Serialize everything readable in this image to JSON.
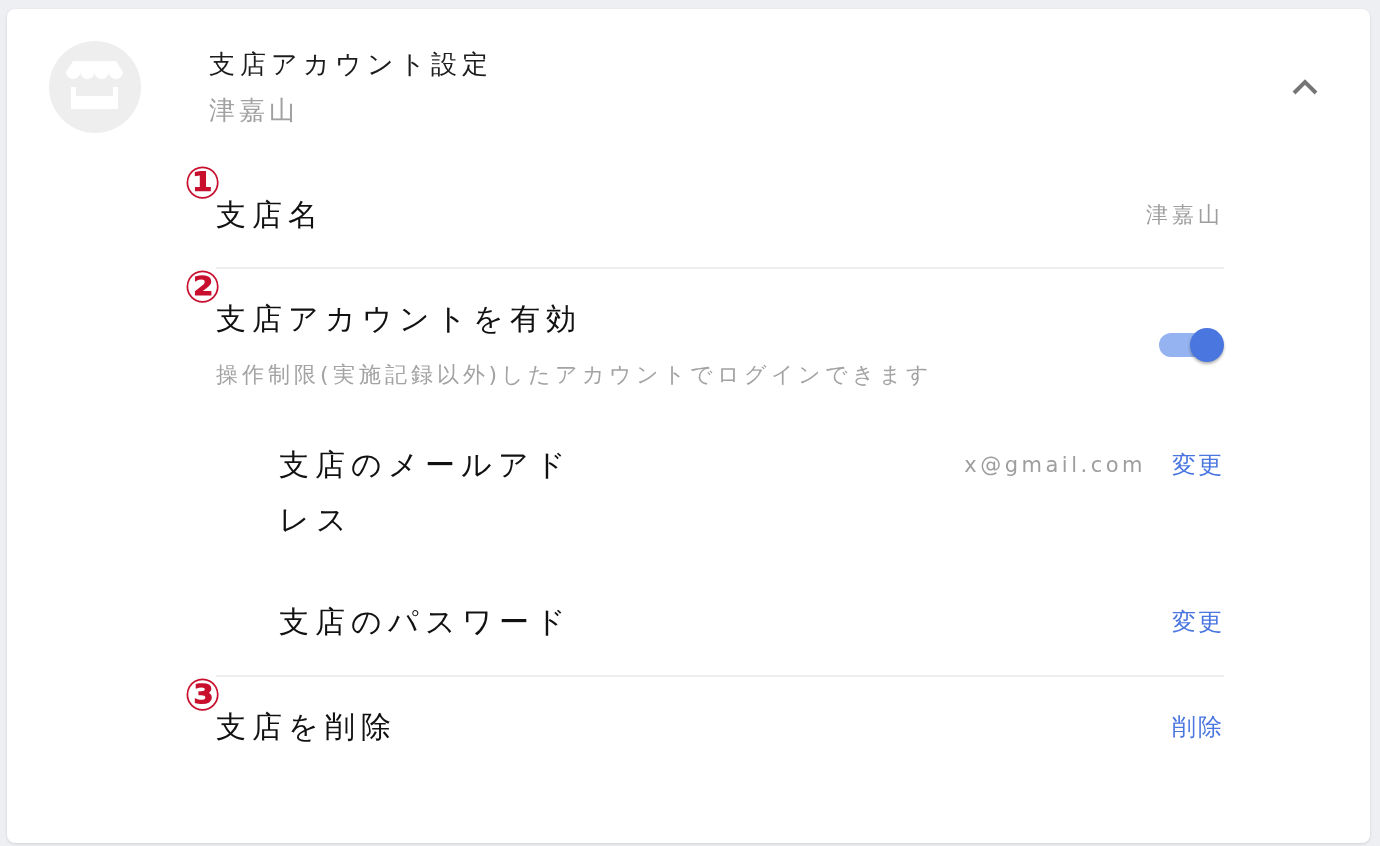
{
  "panel": {
    "title": "支店アカウント設定",
    "subtitle": "津嘉山",
    "expanded": true
  },
  "sections": [
    {
      "marker": "①",
      "kind": "value",
      "label": "支店名",
      "value": "津嘉山"
    },
    {
      "marker": "②",
      "kind": "toggle",
      "label": "支店アカウントを有効",
      "description": "操作制限(実施記録以外)したアカウントでログインできます",
      "on": true,
      "sub_rows": [
        {
          "label": "支店のメールアドレス",
          "value": "x@gmail.com",
          "action": "変更"
        },
        {
          "label": "支店のパスワード",
          "action": "変更"
        }
      ]
    },
    {
      "marker": "③",
      "kind": "action",
      "label": "支店を削除",
      "action": "削除"
    }
  ]
}
